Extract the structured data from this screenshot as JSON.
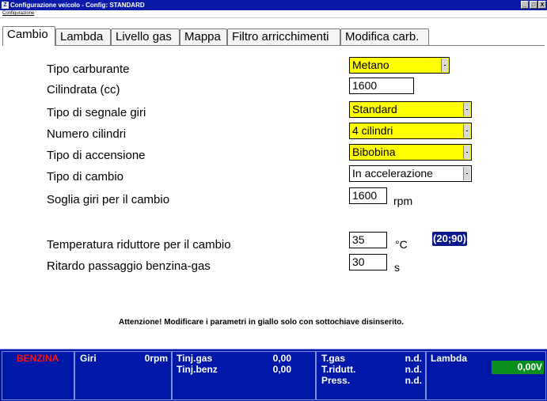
{
  "window": {
    "title": "Configurazione veicolo - Config: STANDARD",
    "app_icon": "Z",
    "buttons": [
      "_",
      "□",
      "X"
    ]
  },
  "menubar": {
    "items": [
      "Configurazione"
    ]
  },
  "tabs": [
    {
      "label": "Cambio",
      "active": true
    },
    {
      "label": "Lambda",
      "active": false
    },
    {
      "label": "Livello gas",
      "active": false
    },
    {
      "label": "Mappa",
      "active": false
    },
    {
      "label": "Filtro arricchimenti",
      "active": false
    },
    {
      "label": "Modifica carb.",
      "active": false
    }
  ],
  "form": {
    "tipo_carburante": {
      "label": "Tipo carburante",
      "value": "Metano"
    },
    "cilindrata": {
      "label": "Cilindrata (cc)",
      "value": "1600"
    },
    "segnale_giri": {
      "label": "Tipo di segnale giri",
      "value": "Standard"
    },
    "numero_cilindri": {
      "label": "Numero cilindri",
      "value": "4 cilindri"
    },
    "accensione": {
      "label": "Tipo di accensione",
      "value": "Bibobina"
    },
    "tipo_cambio": {
      "label": "Tipo di cambio",
      "value": "In accelerazione"
    },
    "soglia_giri": {
      "label": "Soglia giri per il cambio",
      "value": "1600",
      "unit": "rpm"
    },
    "temperatura": {
      "label": "Temperatura riduttore per il cambio",
      "value": "35",
      "unit": "°C",
      "range": "(20;90)"
    },
    "ritardo": {
      "label": "Ritardo passaggio benzina-gas",
      "value": "30",
      "unit": "s"
    }
  },
  "warning": "Attenzione! Modificare i parametri in giallo solo con sottochiave disinserito.",
  "status": {
    "fuel_mode": "BENZINA",
    "giri_label": "Giri",
    "giri_value": "0rpm",
    "tinj_gas_label": "Tinj.gas",
    "tinj_gas_value": "0,00",
    "tinj_benz_label": "Tinj.benz",
    "tinj_benz_value": "0,00",
    "tgas_label": "T.gas",
    "tgas_value": "n.d.",
    "tridutt_label": "T.ridutt.",
    "tridutt_value": "n.d.",
    "press_label": "Press.",
    "press_value": "n.d.",
    "lambda_label": "Lambda",
    "lambda_value": "0,00V"
  },
  "colors": {
    "titlebar": "#0a1aa8",
    "editable_highlight": "#ffff00",
    "statusbar": "#0018a8",
    "fuel_mode": "#ff1010",
    "lambda_indicator": "#0a8f1e"
  }
}
